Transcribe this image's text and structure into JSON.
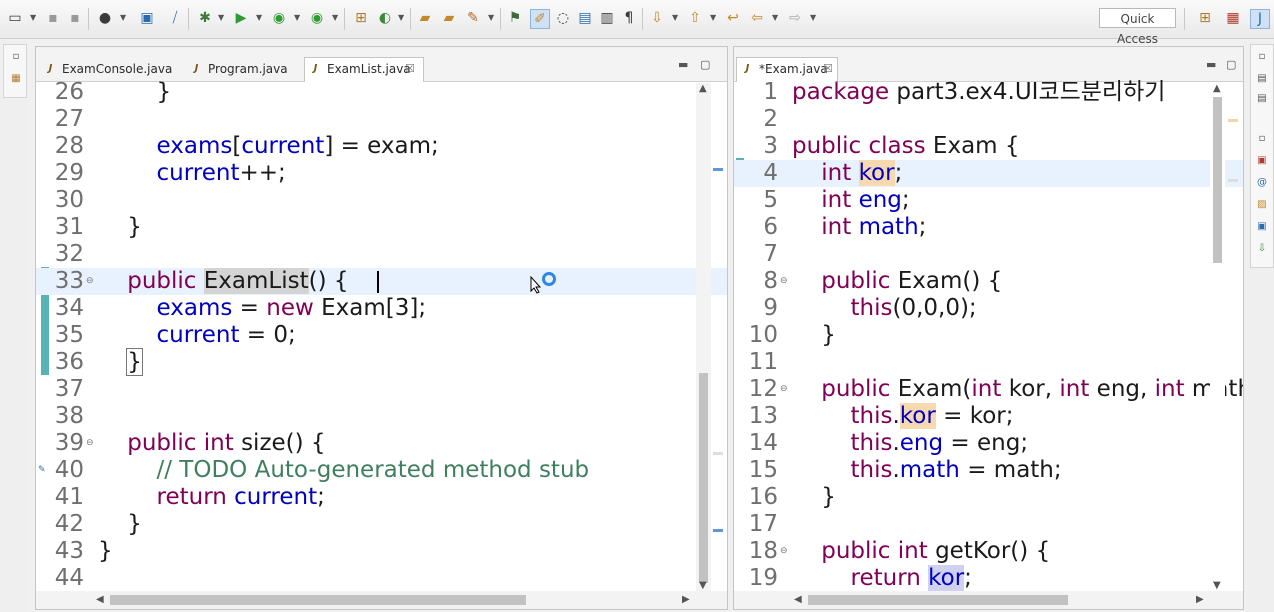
{
  "toolbar": {
    "quick_access_placeholder": "Quick Access",
    "icons": [
      "new-icon",
      "save-icon",
      "save-all-icon",
      "profile-icon",
      "console-icon",
      "skip-breakpoints-icon",
      "debug-icon",
      "run-icon",
      "coverage-icon",
      "external-tools-icon",
      "new-package-icon",
      "new-class-icon",
      "open-type-icon",
      "open-task-icon",
      "search-icon",
      "annotation-icon",
      "toggle-mark-occurrences-icon",
      "block-selection-icon",
      "show-whitespace-icon",
      "next-annotation-icon",
      "prev-annotation-icon",
      "last-edit-icon",
      "back-icon",
      "forward-icon",
      "open-perspective-icon",
      "java-ee-perspective-icon",
      "java-perspective-icon"
    ]
  },
  "left_editor": {
    "tabs": [
      {
        "label": "ExamConsole.java",
        "active": false
      },
      {
        "label": "Program.java",
        "active": false
      },
      {
        "label": "ExamList.java",
        "active": true
      }
    ],
    "close_glyph": "☒",
    "lines": [
      {
        "n": "26",
        "t": "        }"
      },
      {
        "n": "27",
        "t": ""
      },
      {
        "n": "28",
        "t": "        exams[current] = exam;"
      },
      {
        "n": "29",
        "t": "        current++;"
      },
      {
        "n": "30",
        "t": ""
      },
      {
        "n": "31",
        "t": "    }"
      },
      {
        "n": "32",
        "t": ""
      },
      {
        "n": "33",
        "t": "    public ExamList() {"
      },
      {
        "n": "34",
        "t": "        exams = new Exam[3];"
      },
      {
        "n": "35",
        "t": "        current = 0;"
      },
      {
        "n": "36",
        "t": "    }"
      },
      {
        "n": "37",
        "t": ""
      },
      {
        "n": "38",
        "t": ""
      },
      {
        "n": "39",
        "t": "    public int size() {"
      },
      {
        "n": "40",
        "t": "        // TODO Auto-generated method stub"
      },
      {
        "n": "41",
        "t": "        return current;"
      },
      {
        "n": "42",
        "t": "    }"
      },
      {
        "n": "43",
        "t": "}"
      },
      {
        "n": "44",
        "t": ""
      }
    ]
  },
  "right_editor": {
    "tabs": [
      {
        "label": "*Exam.java",
        "active": true
      }
    ],
    "close_glyph": "☒",
    "lines": [
      {
        "n": "1",
        "t": "package part3.ex4.UI코드분리하기"
      },
      {
        "n": "2",
        "t": ""
      },
      {
        "n": "3",
        "t": "public class Exam {"
      },
      {
        "n": "4",
        "t": "    int kor;"
      },
      {
        "n": "5",
        "t": "    int eng;"
      },
      {
        "n": "6",
        "t": "    int math;"
      },
      {
        "n": "7",
        "t": ""
      },
      {
        "n": "8",
        "t": "    public Exam() {"
      },
      {
        "n": "9",
        "t": "        this(0,0,0);"
      },
      {
        "n": "10",
        "t": "    }"
      },
      {
        "n": "11",
        "t": ""
      },
      {
        "n": "12",
        "t": "    public Exam(int kor, int eng, int math) {"
      },
      {
        "n": "13",
        "t": "        this.kor = kor;"
      },
      {
        "n": "14",
        "t": "        this.eng = eng;"
      },
      {
        "n": "15",
        "t": "        this.math = math;"
      },
      {
        "n": "16",
        "t": "    }"
      },
      {
        "n": "17",
        "t": ""
      },
      {
        "n": "18",
        "t": "    public int getKor() {"
      },
      {
        "n": "19",
        "t": "        return kor;"
      }
    ]
  }
}
